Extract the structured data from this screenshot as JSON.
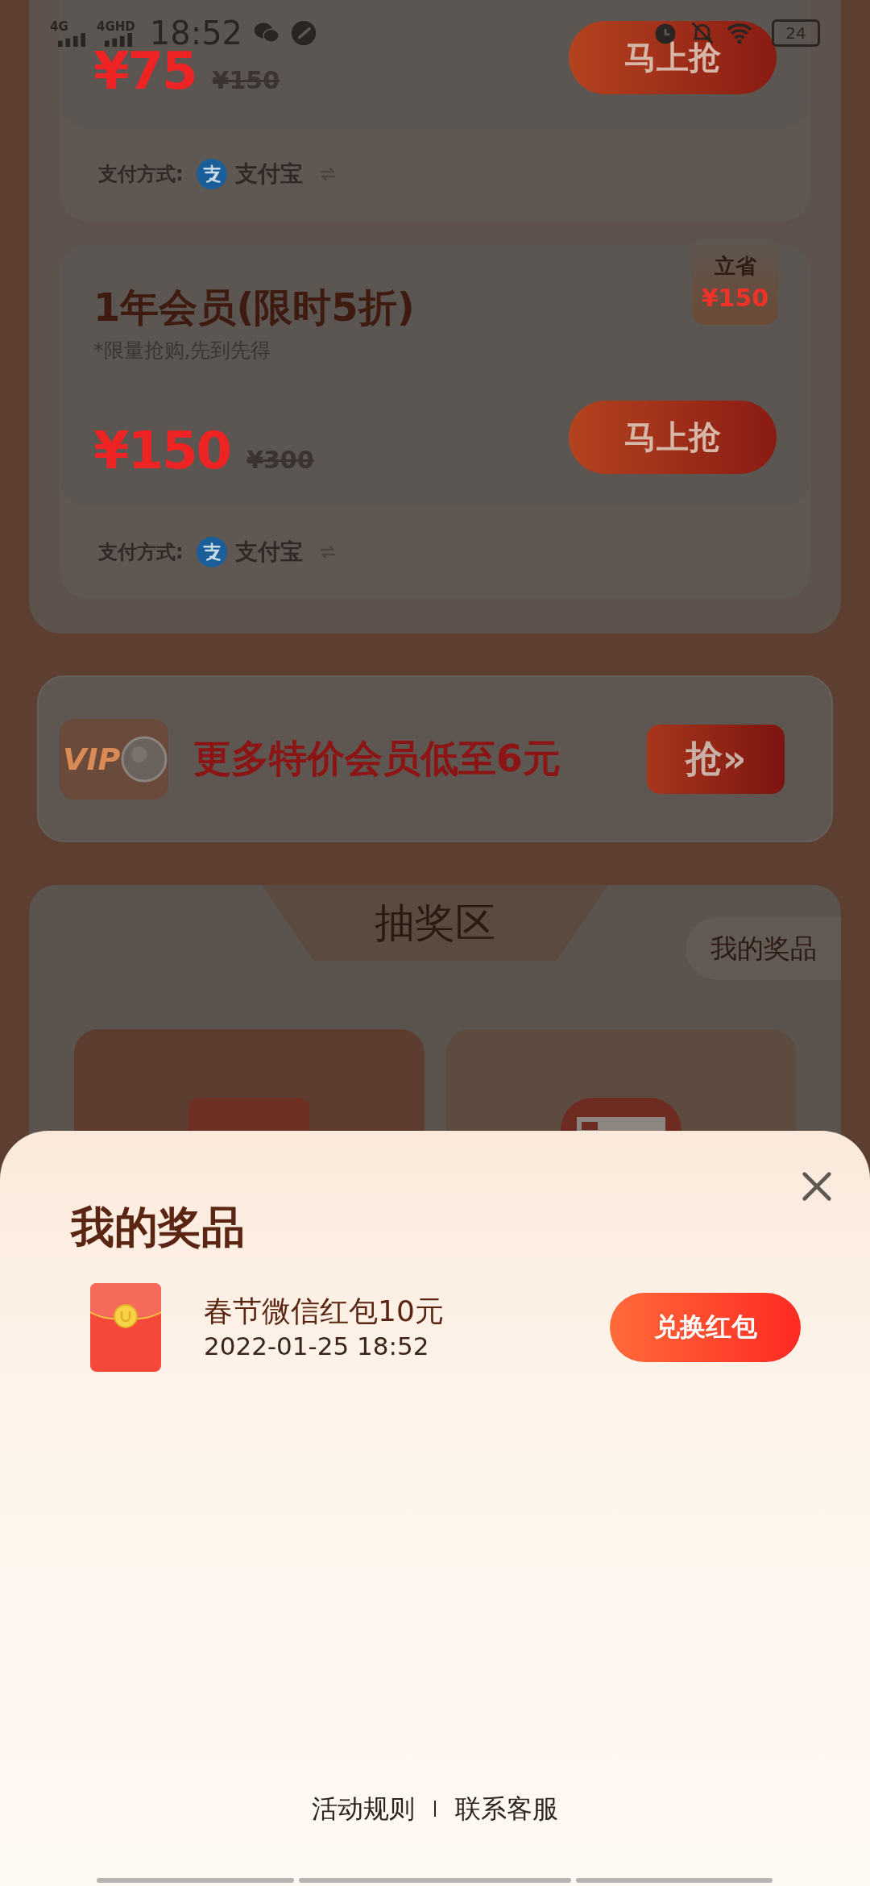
{
  "status_bar": {
    "network_1": "4G",
    "network_2": "4GHD",
    "time": "18:52",
    "battery": "24"
  },
  "offers": [
    {
      "price": "¥75",
      "original_price": "¥150",
      "button": "马上抢",
      "payment_label": "支付方式:",
      "payment_method": "支付宝"
    },
    {
      "title": "1年会员(限时5折)",
      "note": "*限量抢购,先到先得",
      "badge": {
        "label": "立省",
        "amount": "¥150"
      },
      "price": "¥150",
      "original_price": "¥300",
      "button": "马上抢",
      "payment_label": "支付方式:",
      "payment_method": "支付宝"
    }
  ],
  "banner": {
    "logo": "VIP",
    "text": "更多特价会员低至6元",
    "button": "抢»"
  },
  "lottery": {
    "title": "抽奖区",
    "my_prizes_tab": "我的奖品"
  },
  "prize_sheet": {
    "title": "我的奖品",
    "prizes": [
      {
        "name": "春节微信红包10元",
        "time": "2022-01-25 18:52",
        "button": "兑换红包"
      }
    ],
    "footer_links": [
      "活动规则",
      "联系客服"
    ]
  }
}
